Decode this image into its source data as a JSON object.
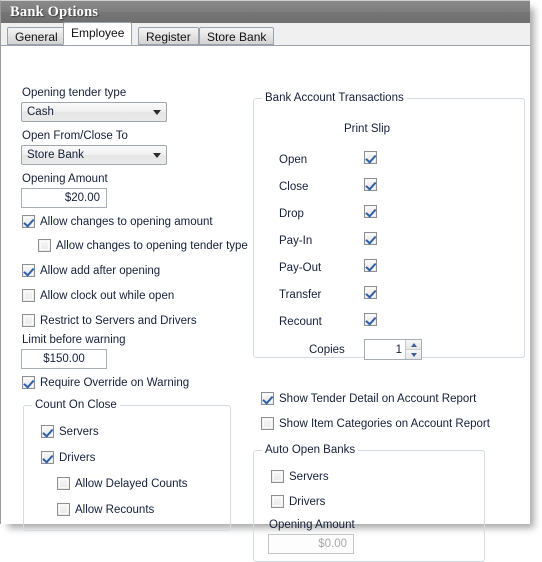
{
  "window": {
    "title": "Bank Options"
  },
  "tabs": [
    {
      "label": "General",
      "selected": false
    },
    {
      "label": "Employee",
      "selected": true
    },
    {
      "label": "Register",
      "selected": false
    },
    {
      "label": "Store Bank",
      "selected": false
    }
  ],
  "left": {
    "opening_tender_type_label": "Opening tender type",
    "opening_tender_type_value": "Cash",
    "open_from_close_to_label": "Open From/Close To",
    "open_from_close_to_value": "Store Bank",
    "opening_amount_label": "Opening Amount",
    "opening_amount_value": "$20.00",
    "allow_changes_opening_amount": "Allow changes to opening amount",
    "allow_changes_opening_tender_type": "Allow changes to opening tender type",
    "allow_add_after_opening": "Allow add after opening",
    "allow_clock_out_while_open": "Allow clock out while open",
    "restrict_to_servers_and_drivers": "Restrict to Servers and Drivers",
    "limit_before_warning_label": "Limit before warning",
    "limit_before_warning_value": "$150.00",
    "require_override_on_warning": "Require Override on Warning"
  },
  "count_on_close": {
    "title": "Count On Close",
    "servers": "Servers",
    "drivers": "Drivers",
    "allow_delayed_counts": "Allow Delayed Counts",
    "allow_recounts": "Allow Recounts"
  },
  "bank_account_transactions": {
    "title": "Bank Account Transactions",
    "column_header": "Print Slip",
    "rows": [
      {
        "label": "Open",
        "checked": true
      },
      {
        "label": "Close",
        "checked": true
      },
      {
        "label": "Drop",
        "checked": true
      },
      {
        "label": "Pay-In",
        "checked": true
      },
      {
        "label": "Pay-Out",
        "checked": true
      },
      {
        "label": "Transfer",
        "checked": true
      },
      {
        "label": "Recount",
        "checked": true
      }
    ],
    "copies_label": "Copies",
    "copies_value": "1"
  },
  "right_options": {
    "show_tender_detail": "Show Tender Detail on Account Report",
    "show_item_categories": "Show Item Categories on Account Report"
  },
  "auto_open_banks": {
    "title": "Auto Open Banks",
    "servers": "Servers",
    "drivers": "Drivers",
    "opening_amount_label": "Opening Amount",
    "opening_amount_value": "$0.00"
  },
  "colors": {
    "titlebar": "#7d7d7d",
    "check": "#2f5fa8",
    "group_border": "#d4dbe3"
  }
}
